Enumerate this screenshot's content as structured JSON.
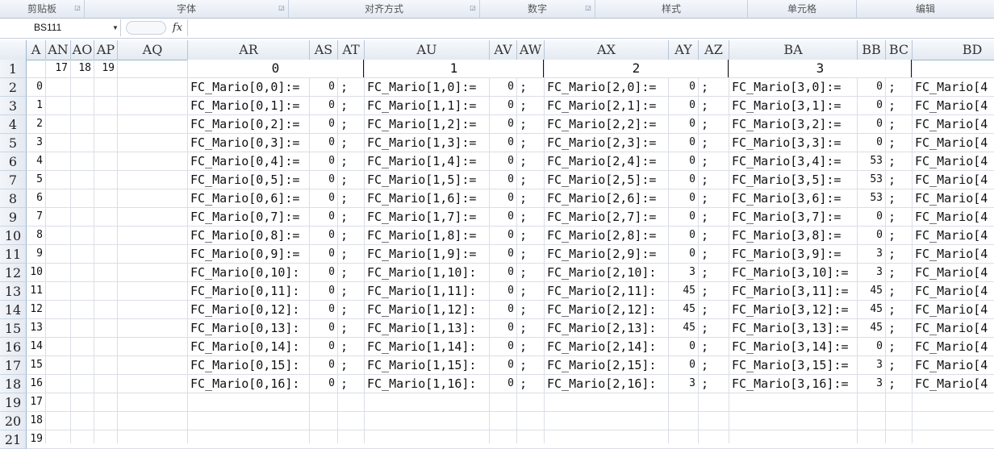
{
  "ribbon": {
    "groups": [
      "剪贴板",
      "字体",
      "对齐方式",
      "数字",
      "样式",
      "单元格",
      "编辑"
    ]
  },
  "formula_bar": {
    "name_box": "BS111",
    "fx_label": "fx",
    "content": ""
  },
  "columns": [
    "A",
    "AN",
    "AO",
    "AP",
    "AQ",
    "AR",
    "AS",
    "AT",
    "AU",
    "AV",
    "AW",
    "AX",
    "AY",
    "AZ",
    "BA",
    "BB",
    "BC",
    "BD"
  ],
  "rows": [
    "1",
    "2",
    "3",
    "4",
    "5",
    "6",
    "7",
    "8",
    "9",
    "10",
    "11",
    "12",
    "13",
    "14",
    "15",
    "16",
    "17",
    "18",
    "19",
    "20",
    "21"
  ],
  "row1": {
    "an": "17",
    "ao": "18",
    "ap": "19",
    "blocks": [
      "0",
      "1",
      "2",
      "3"
    ]
  },
  "col_a": [
    "0",
    "1",
    "2",
    "3",
    "4",
    "5",
    "6",
    "7",
    "8",
    "9",
    "10",
    "11",
    "12",
    "13",
    "14",
    "15",
    "16",
    "17",
    "18",
    "19"
  ],
  "blocks": [
    {
      "text": [
        "FC_Mario[0,0]:=",
        "FC_Mario[0,1]:=",
        "FC_Mario[0,2]:=",
        "FC_Mario[0,3]:=",
        "FC_Mario[0,4]:=",
        "FC_Mario[0,5]:=",
        "FC_Mario[0,6]:=",
        "FC_Mario[0,7]:=",
        "FC_Mario[0,8]:=",
        "FC_Mario[0,9]:=",
        "FC_Mario[0,10]:",
        "FC_Mario[0,11]:",
        "FC_Mario[0,12]:",
        "FC_Mario[0,13]:",
        "FC_Mario[0,14]:",
        "FC_Mario[0,15]:",
        "FC_Mario[0,16]:"
      ],
      "values": [
        "0",
        "0",
        "0",
        "0",
        "0",
        "0",
        "0",
        "0",
        "0",
        "0",
        "0",
        "0",
        "0",
        "0",
        "0",
        "0",
        "0"
      ]
    },
    {
      "text": [
        "FC_Mario[1,0]:=",
        "FC_Mario[1,1]:=",
        "FC_Mario[1,2]:=",
        "FC_Mario[1,3]:=",
        "FC_Mario[1,4]:=",
        "FC_Mario[1,5]:=",
        "FC_Mario[1,6]:=",
        "FC_Mario[1,7]:=",
        "FC_Mario[1,8]:=",
        "FC_Mario[1,9]:=",
        "FC_Mario[1,10]:",
        "FC_Mario[1,11]:",
        "FC_Mario[1,12]:",
        "FC_Mario[1,13]:",
        "FC_Mario[1,14]:",
        "FC_Mario[1,15]:",
        "FC_Mario[1,16]:"
      ],
      "values": [
        "0",
        "0",
        "0",
        "0",
        "0",
        "0",
        "0",
        "0",
        "0",
        "0",
        "0",
        "0",
        "0",
        "0",
        "0",
        "0",
        "0"
      ]
    },
    {
      "text": [
        "FC_Mario[2,0]:=",
        "FC_Mario[2,1]:=",
        "FC_Mario[2,2]:=",
        "FC_Mario[2,3]:=",
        "FC_Mario[2,4]:=",
        "FC_Mario[2,5]:=",
        "FC_Mario[2,6]:=",
        "FC_Mario[2,7]:=",
        "FC_Mario[2,8]:=",
        "FC_Mario[2,9]:=",
        "FC_Mario[2,10]:",
        "FC_Mario[2,11]:",
        "FC_Mario[2,12]:",
        "FC_Mario[2,13]:",
        "FC_Mario[2,14]:",
        "FC_Mario[2,15]:",
        "FC_Mario[2,16]:"
      ],
      "values": [
        "0",
        "0",
        "0",
        "0",
        "0",
        "0",
        "0",
        "0",
        "0",
        "0",
        "3",
        "45",
        "45",
        "45",
        "0",
        "0",
        "3"
      ]
    },
    {
      "text": [
        "FC_Mario[3,0]:=",
        "FC_Mario[3,1]:=",
        "FC_Mario[3,2]:=",
        "FC_Mario[3,3]:=",
        "FC_Mario[3,4]:=",
        "FC_Mario[3,5]:=",
        "FC_Mario[3,6]:=",
        "FC_Mario[3,7]:=",
        "FC_Mario[3,8]:=",
        "FC_Mario[3,9]:=",
        "FC_Mario[3,10]:=",
        "FC_Mario[3,11]:=",
        "FC_Mario[3,12]:=",
        "FC_Mario[3,13]:=",
        "FC_Mario[3,14]:=",
        "FC_Mario[3,15]:=",
        "FC_Mario[3,16]:="
      ],
      "values": [
        "0",
        "0",
        "0",
        "0",
        "53",
        "53",
        "53",
        "0",
        "0",
        "3",
        "3",
        "45",
        "45",
        "45",
        "0",
        "3",
        "3"
      ]
    }
  ],
  "semicolon": ";",
  "col_bd_text": [
    "FC_Mario[4",
    "FC_Mario[4",
    "FC_Mario[4",
    "FC_Mario[4",
    "FC_Mario[4",
    "FC_Mario[4",
    "FC_Mario[4",
    "FC_Mario[4",
    "FC_Mario[4",
    "FC_Mario[4",
    "FC_Mario[4",
    "FC_Mario[4",
    "FC_Mario[4",
    "FC_Mario[4",
    "FC_Mario[4",
    "FC_Mario[4",
    "FC_Mario[4"
  ]
}
